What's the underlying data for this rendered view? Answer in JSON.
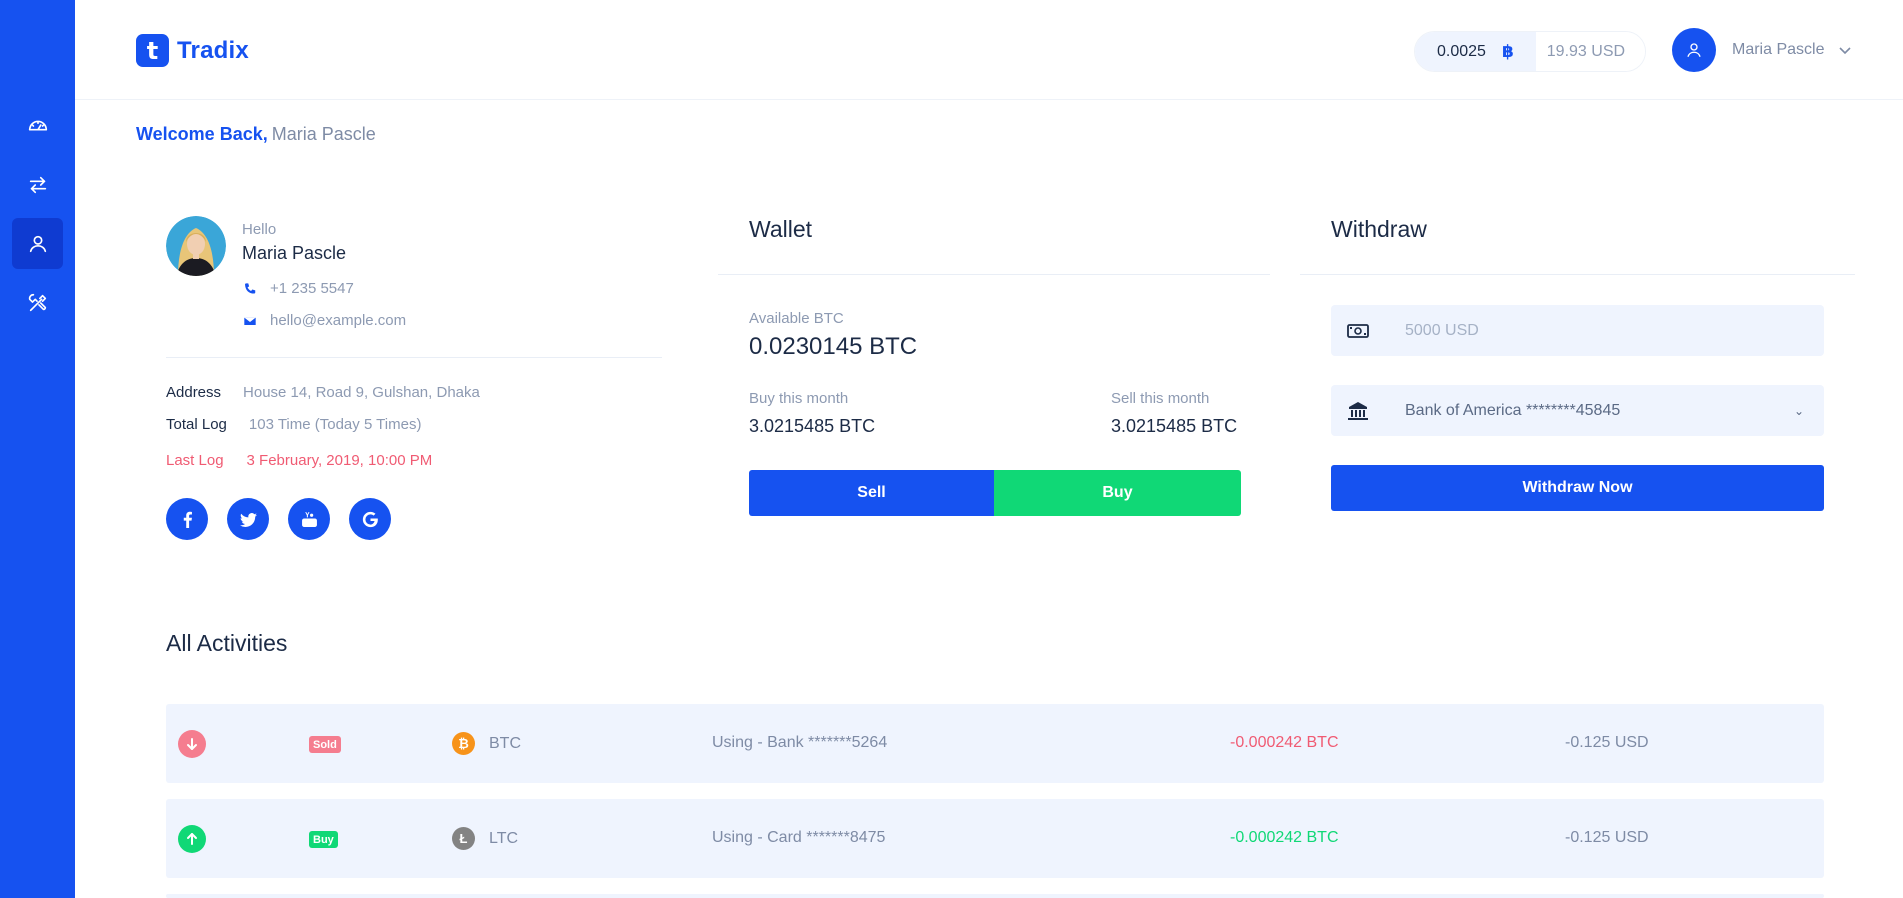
{
  "app": {
    "logo_letter": "t",
    "name": "Tradix"
  },
  "sidebar": {
    "items": [
      {
        "name": "dashboard",
        "icon": "speedometer-icon",
        "active": false
      },
      {
        "name": "exchange",
        "icon": "swap-arrows-icon",
        "active": false
      },
      {
        "name": "profile",
        "icon": "user-icon",
        "active": true
      },
      {
        "name": "settings",
        "icon": "tools-icon",
        "active": false
      }
    ]
  },
  "header": {
    "balance_btc": "0.0025",
    "btc_symbol": "฿",
    "balance_usd": "19.93 USD",
    "user_name": "Maria Pascle"
  },
  "welcome": {
    "greeting": "Welcome Back,",
    "name": "Maria Pascle"
  },
  "profile": {
    "hello": "Hello",
    "name": "Maria Pascle",
    "phone": "+1 235 5547",
    "email": "hello@example.com",
    "address_label": "Address",
    "address_value": "House 14, Road 9, Gulshan, Dhaka",
    "total_log_label": "Total Log",
    "total_log_value": "103 Time (Today 5 Times)",
    "last_log_label": "Last Log",
    "last_log_value": "3 February, 2019, 10:00 PM",
    "socials": [
      "facebook-icon",
      "twitter-icon",
      "youtube-icon",
      "google-icon"
    ]
  },
  "wallet": {
    "title": "Wallet",
    "available_label": "Available BTC",
    "available_value": "0.0230145 BTC",
    "buy_month_label": "Buy this month",
    "buy_month_value": "3.0215485 BTC",
    "sell_month_label": "Sell this month",
    "sell_month_value": "3.0215485 BTC",
    "sell_btn": "Sell",
    "buy_btn": "Buy"
  },
  "withdraw": {
    "title": "Withdraw",
    "amount_placeholder": "5000 USD",
    "bank_selected": "Bank of America ********45845",
    "button": "Withdraw Now"
  },
  "activities": {
    "title": "All Activities",
    "rows": [
      {
        "type": "Sold",
        "direction": "down",
        "coin": "BTC",
        "coin_glyph": "₿",
        "method": "Using - Bank *******5264",
        "amount": "-0.000242 BTC",
        "usd": "-0.125 USD"
      },
      {
        "type": "Buy",
        "direction": "up",
        "coin": "LTC",
        "coin_glyph": "Ł",
        "method": "Using - Card *******8475",
        "amount": "-0.000242 BTC",
        "usd": "-0.125 USD"
      }
    ]
  },
  "colors": {
    "primary": "#1652f0",
    "success": "#10d876",
    "danger": "#f05b73",
    "btc": "#f7931a",
    "ltc": "#838383",
    "light_bg": "#eff4fe"
  }
}
